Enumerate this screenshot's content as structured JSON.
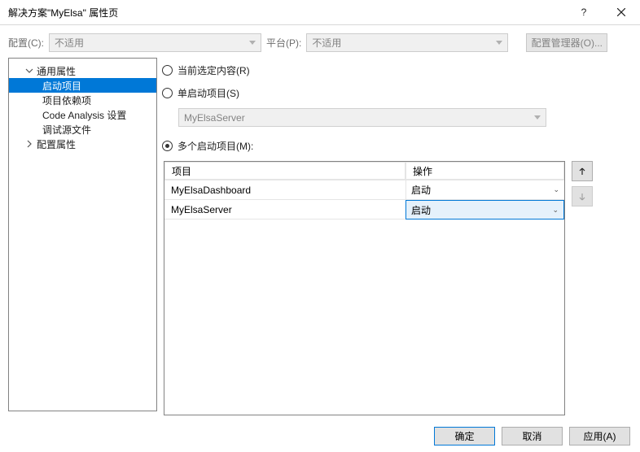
{
  "titlebar": {
    "title": "解决方案\"MyElsa\" 属性页"
  },
  "configRow": {
    "configLabel": "配置(C):",
    "configValue": "不适用",
    "platformLabel": "平台(P):",
    "platformValue": "不适用",
    "managerButton": "配置管理器(O)..."
  },
  "tree": {
    "node0": "通用属性",
    "node0_0": "启动项目",
    "node0_1": "项目依赖项",
    "node0_2": "Code Analysis 设置",
    "node0_3": "调试源文件",
    "node1": "配置属性"
  },
  "radios": {
    "current": "当前选定内容(R)",
    "single": "单启动项目(S)",
    "multi": "多个启动项目(M):"
  },
  "singleCombo": "MyElsaServer",
  "grid": {
    "header_project": "项目",
    "header_action": "操作",
    "rows": [
      {
        "project": "MyElsaDashboard",
        "action": "启动"
      },
      {
        "project": "MyElsaServer",
        "action": "启动"
      }
    ]
  },
  "footer": {
    "ok": "确定",
    "cancel": "取消",
    "apply": "应用(A)"
  }
}
